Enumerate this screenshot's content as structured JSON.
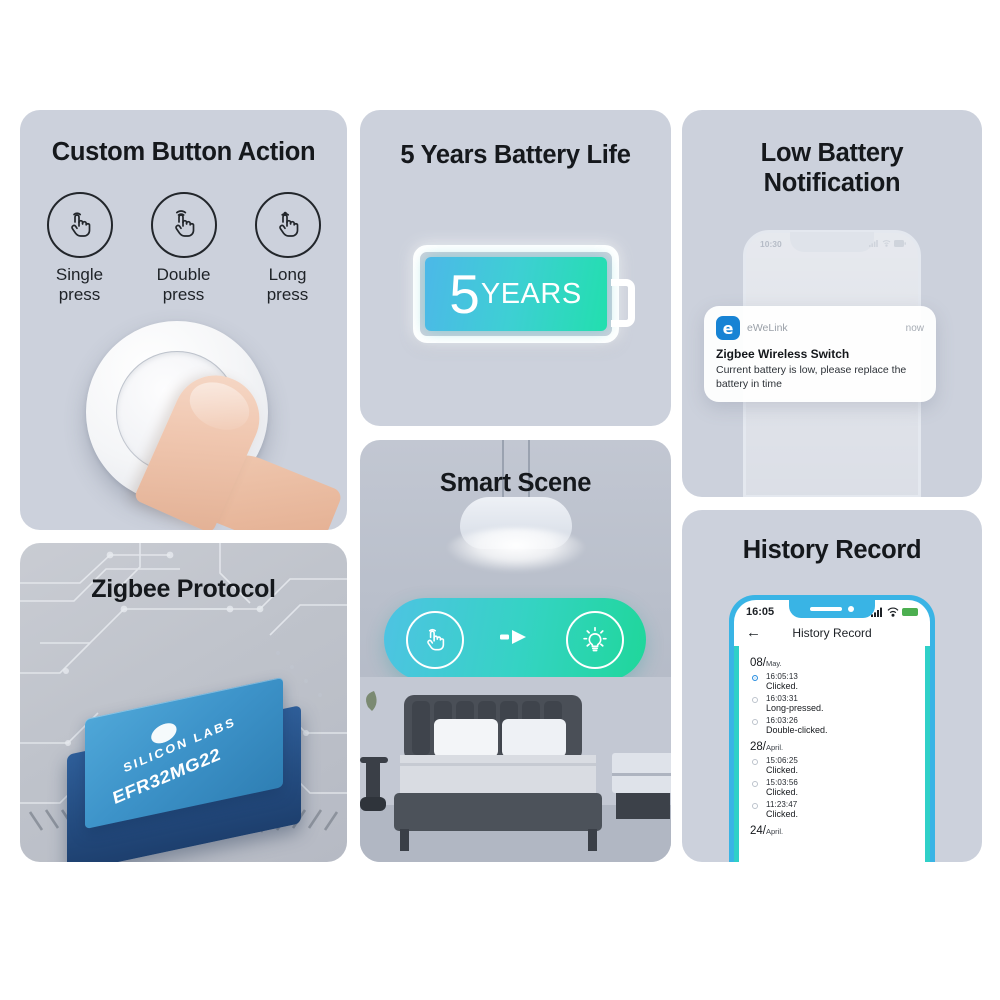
{
  "panels": {
    "custom_button": {
      "title": "Custom Button Action",
      "actions": [
        {
          "icon": "single-tap-icon",
          "label": "Single\npress",
          "line1": "Single",
          "line2": "press"
        },
        {
          "icon": "double-tap-icon",
          "label": "Double\npress",
          "line1": "Double",
          "line2": "press"
        },
        {
          "icon": "long-press-icon",
          "label": "Long\npress",
          "line1": "Long",
          "line2": "press"
        }
      ],
      "device_image_alt": "finger-pressing-round-wireless-switch"
    },
    "zigbee": {
      "title": "Zigbee Protocol",
      "chip_brand": "SILICON LABS",
      "chip_model": "EFR32MG22",
      "chip_logo_icon": "silicon-labs-logo-icon"
    },
    "battery": {
      "title": "5 Years Battery Life",
      "badge_number": "5",
      "badge_unit": "YEARS",
      "fill_gradient_start": "#4cb8e8",
      "fill_gradient_end": "#22dfae"
    },
    "smart_scene": {
      "title": "Smart Scene",
      "trigger_icon": "tap-hand-icon",
      "arrow_icon": "arrow-right-icon",
      "result_icon": "light-bulb-icon",
      "pill_gradient_start": "#4ec3e3",
      "pill_gradient_end": "#1fd79a"
    },
    "low_battery": {
      "title_line1": "Low Battery",
      "title_line2": "Notification",
      "phone_time": "10:30",
      "notification": {
        "app_icon_letter": "e",
        "app_name": "eWeLink",
        "timestamp": "now",
        "title": "Zigbee Wireless Switch",
        "body": "Current battery is low, please replace the battery in time",
        "icon_color": "#1783d4"
      }
    },
    "history": {
      "title": "History Record",
      "phone": {
        "status_time": "16:05",
        "back_icon": "back-arrow-icon",
        "nav_title": "History Record",
        "signal_icon": "signal-icon",
        "wifi_icon": "wifi-icon",
        "battery_icon": "battery-full-icon"
      },
      "groups": [
        {
          "day": "08",
          "month": "May.",
          "entries": [
            {
              "time": "16:05:13",
              "action": "Clicked.",
              "active": true
            },
            {
              "time": "16:03:31",
              "action": "Long-pressed.",
              "active": false
            },
            {
              "time": "16:03:26",
              "action": "Double-clicked.",
              "active": false
            }
          ]
        },
        {
          "day": "28",
          "month": "April.",
          "entries": [
            {
              "time": "15:06:25",
              "action": "Clicked.",
              "active": false
            },
            {
              "time": "15:03:56",
              "action": "Clicked.",
              "active": false
            },
            {
              "time": "11:23:47",
              "action": "Clicked.",
              "active": false
            }
          ]
        },
        {
          "day": "24",
          "month": "April.",
          "entries": []
        }
      ],
      "rail_color": "#2fd0c8"
    }
  }
}
